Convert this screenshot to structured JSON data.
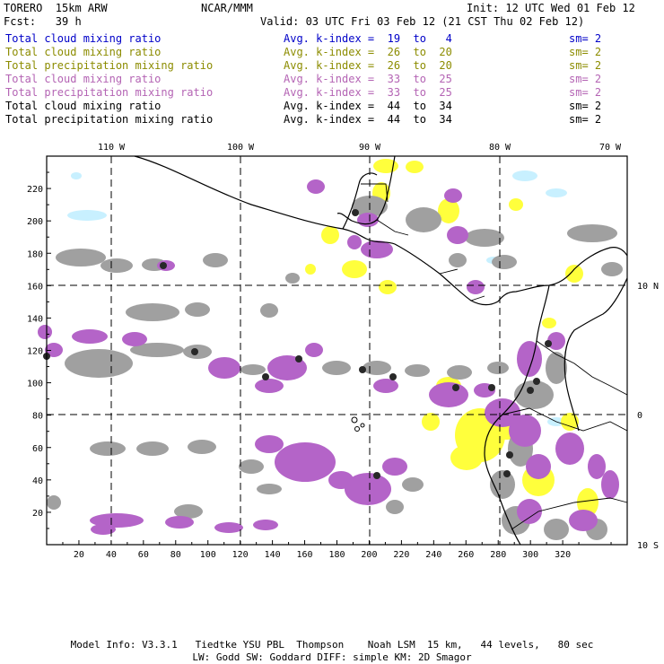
{
  "header": {
    "model": "TORERO  15km ARW",
    "center": "NCAR/MMM",
    "init": "Init: 12 UTC Wed 01 Feb 12",
    "fcst": "Fcst:   39 h",
    "valid": "Valid: 03 UTC Fri 03 Feb 12 (21 CST Thu 02 Feb 12)"
  },
  "legend": [
    {
      "name": "Total cloud mixing ratio",
      "index": "Avg. k-index =  19  to   4",
      "sm": "sm= 2",
      "color": "#0000c8"
    },
    {
      "name": "Total cloud mixing ratio",
      "index": "Avg. k-index =  26  to  20",
      "sm": "sm= 2",
      "color": "#8c8c00"
    },
    {
      "name": "Total precipitation mixing ratio",
      "index": "Avg. k-index =  26  to  20",
      "sm": "sm= 2",
      "color": "#8c8c00"
    },
    {
      "name": "Total cloud mixing ratio",
      "index": "Avg. k-index =  33  to  25",
      "sm": "sm= 2",
      "color": "#b464b4"
    },
    {
      "name": "Total precipitation mixing ratio",
      "index": "Avg. k-index =  33  to  25",
      "sm": "sm= 2",
      "color": "#b464b4"
    },
    {
      "name": "Total cloud mixing ratio",
      "index": "Avg. k-index =  44  to  34",
      "sm": "sm= 2",
      "color": "#000000"
    },
    {
      "name": "Total precipitation mixing ratio",
      "index": "Avg. k-index =  44  to  34",
      "sm": "sm= 2",
      "color": "#000000"
    }
  ],
  "map": {
    "x_ticks": [
      "20",
      "40",
      "60",
      "80",
      "100",
      "120",
      "140",
      "160",
      "180",
      "200",
      "220",
      "240",
      "260",
      "280",
      "300",
      "320"
    ],
    "y_ticks": [
      "20",
      "40",
      "60",
      "80",
      "100",
      "120",
      "140",
      "160",
      "180",
      "200",
      "220"
    ],
    "lon_labels": [
      "110 W",
      "100 W",
      "90 W",
      "80 W",
      "70 W"
    ],
    "lat_labels": [
      "10 N",
      "0",
      "10 S"
    ],
    "colors": {
      "gray": "#a0a0a0",
      "purple": "#b464c8",
      "yellow": "#ffff3c",
      "lightblue": "#c8f0ff",
      "dark": "#282828"
    }
  },
  "footer": {
    "line1": "Model Info: V3.3.1   Tiedtke YSU PBL  Thompson    Noah LSM  15 km,   44 levels,   80 sec",
    "line2": "LW: Godd SW: Goddard DIFF: simple KM: 2D Smagor"
  }
}
